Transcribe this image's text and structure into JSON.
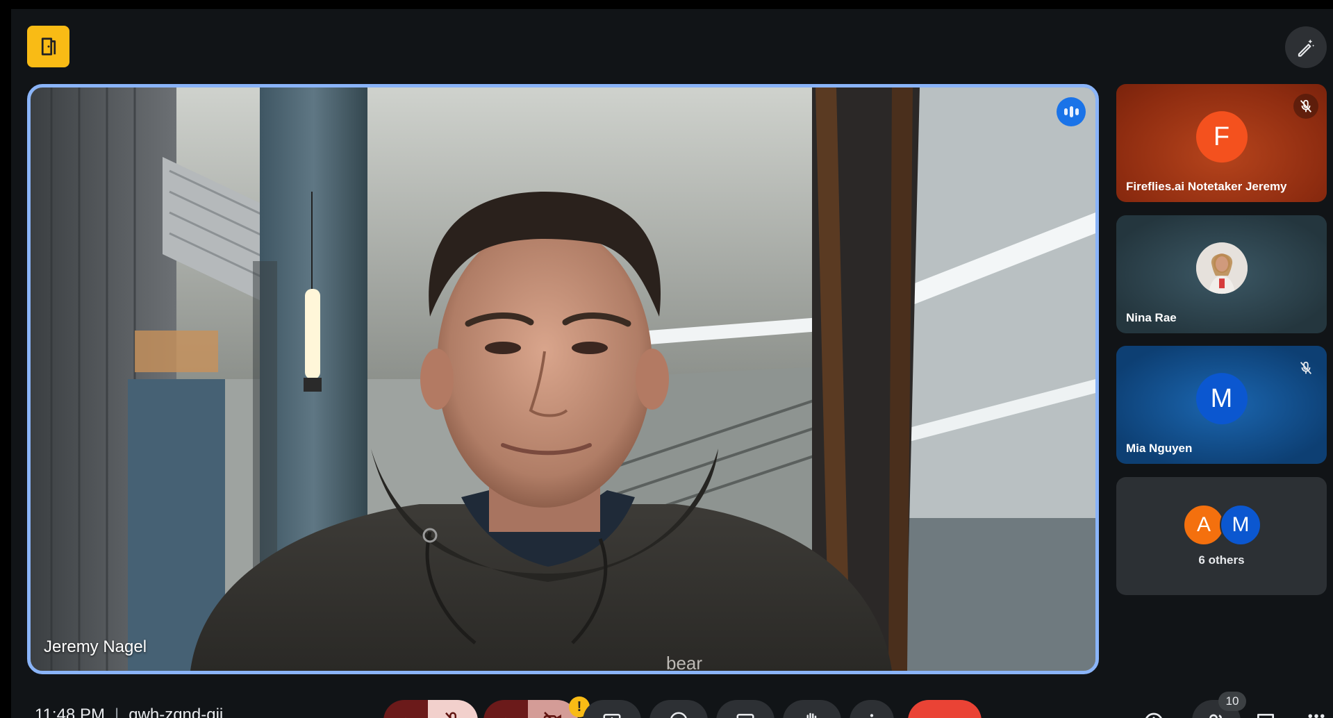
{
  "meeting": {
    "time": "11:48 PM",
    "code": "qwh-zqnd-gii"
  },
  "main_speaker": {
    "name": "Jeremy Nagel"
  },
  "participants": [
    {
      "name": "Fireflies.ai Notetaker Jeremy",
      "initial": "F",
      "avatar_color": "#f4511e",
      "muted": true
    },
    {
      "name": "Nina Rae",
      "initial": "",
      "avatar_color": "#e0d6cf",
      "muted": false
    },
    {
      "name": "Mia Nguyen",
      "initial": "M",
      "avatar_color": "#0b57d0",
      "muted": true
    }
  ],
  "others": {
    "label": "6 others",
    "avatars": [
      {
        "initial": "A",
        "color": "#f4700e"
      },
      {
        "initial": "M",
        "color": "#0b57d0"
      }
    ]
  },
  "toolbar": {
    "people_count": "10",
    "mic_state": "off",
    "camera_state": "off",
    "camera_warning": "!"
  },
  "colors": {
    "accent_border": "#8ab4f8",
    "end_call": "#ea4335",
    "room_badge": "#f9bb15"
  }
}
